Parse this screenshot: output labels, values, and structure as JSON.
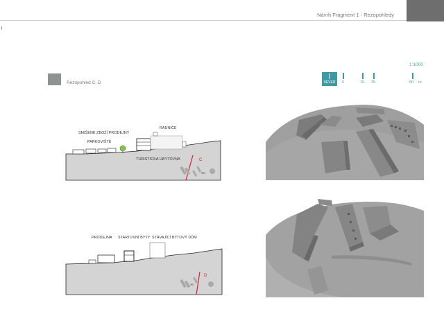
{
  "header": {
    "title": "Návrh Fragment 1 - Rezopohledy"
  },
  "legend": {
    "label": "Rezopohled C, D",
    "swatch_color": "#8f9492"
  },
  "scale": {
    "ratio": "1:1000",
    "north_label": "SEVER",
    "ticks": [
      "0",
      "15",
      "25",
      "50",
      "m"
    ],
    "accent_color": "#3d9aa4"
  },
  "section_c": {
    "labels": {
      "radnice": "RADNICE",
      "smisene": "SMÍŠENÉ ZBOŽÍ  PRODEJNY",
      "parkoviste": "PARKOVIŠTĚ",
      "turisticka": "TURISTICKÁ UBYTOVNA"
    },
    "cut_letter": "C"
  },
  "section_d": {
    "labels": {
      "prodejna": "PRODEJNA",
      "startovni": "STARTOVNÍ BYTY",
      "stavajici": "STÁVAJÍCÍ BYTOVÝ DŮM"
    },
    "cut_letter": "D"
  },
  "colors": {
    "cut_line": "#d2232a",
    "terrain": "#d4d4d4",
    "model": "#9a9a9a"
  }
}
